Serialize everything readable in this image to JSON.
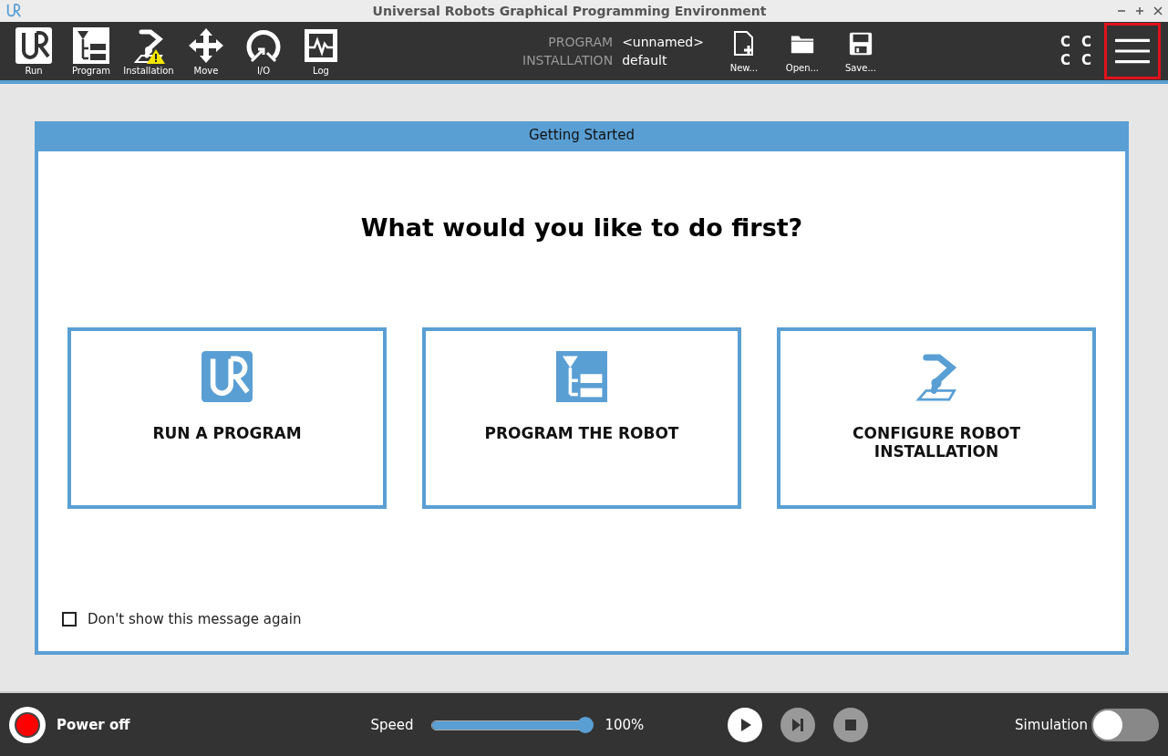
{
  "window": {
    "title": "Universal Robots Graphical Programming Environment"
  },
  "nav": [
    {
      "label": "Run"
    },
    {
      "label": "Program"
    },
    {
      "label": "Installation"
    },
    {
      "label": "Move"
    },
    {
      "label": "I/O"
    },
    {
      "label": "Log"
    }
  ],
  "info": [
    {
      "label": "PROGRAM",
      "value": "<unnamed>"
    },
    {
      "label": "INSTALLATION",
      "value": "default"
    }
  ],
  "file_buttons": [
    {
      "label": "New..."
    },
    {
      "label": "Open..."
    },
    {
      "label": "Save..."
    }
  ],
  "status_letters": [
    "C",
    "C",
    "C",
    "C"
  ],
  "menu_button": {
    "highlighted": true
  },
  "dialog": {
    "title": "Getting Started",
    "heading": "What would you like to do first?",
    "options": [
      {
        "label": "RUN A PROGRAM"
      },
      {
        "label": "PROGRAM THE ROBOT"
      },
      {
        "label": "CONFIGURE ROBOT INSTALLATION"
      }
    ],
    "checkbox": {
      "label": "Don't show this message again",
      "checked": false
    }
  },
  "footer": {
    "power": "Power off",
    "speed_label": "Speed",
    "speed": {
      "level": 1.0
    },
    "speed_reading": "100%",
    "simulation_label": "Simulation",
    "simulation": {
      "on": false
    }
  }
}
